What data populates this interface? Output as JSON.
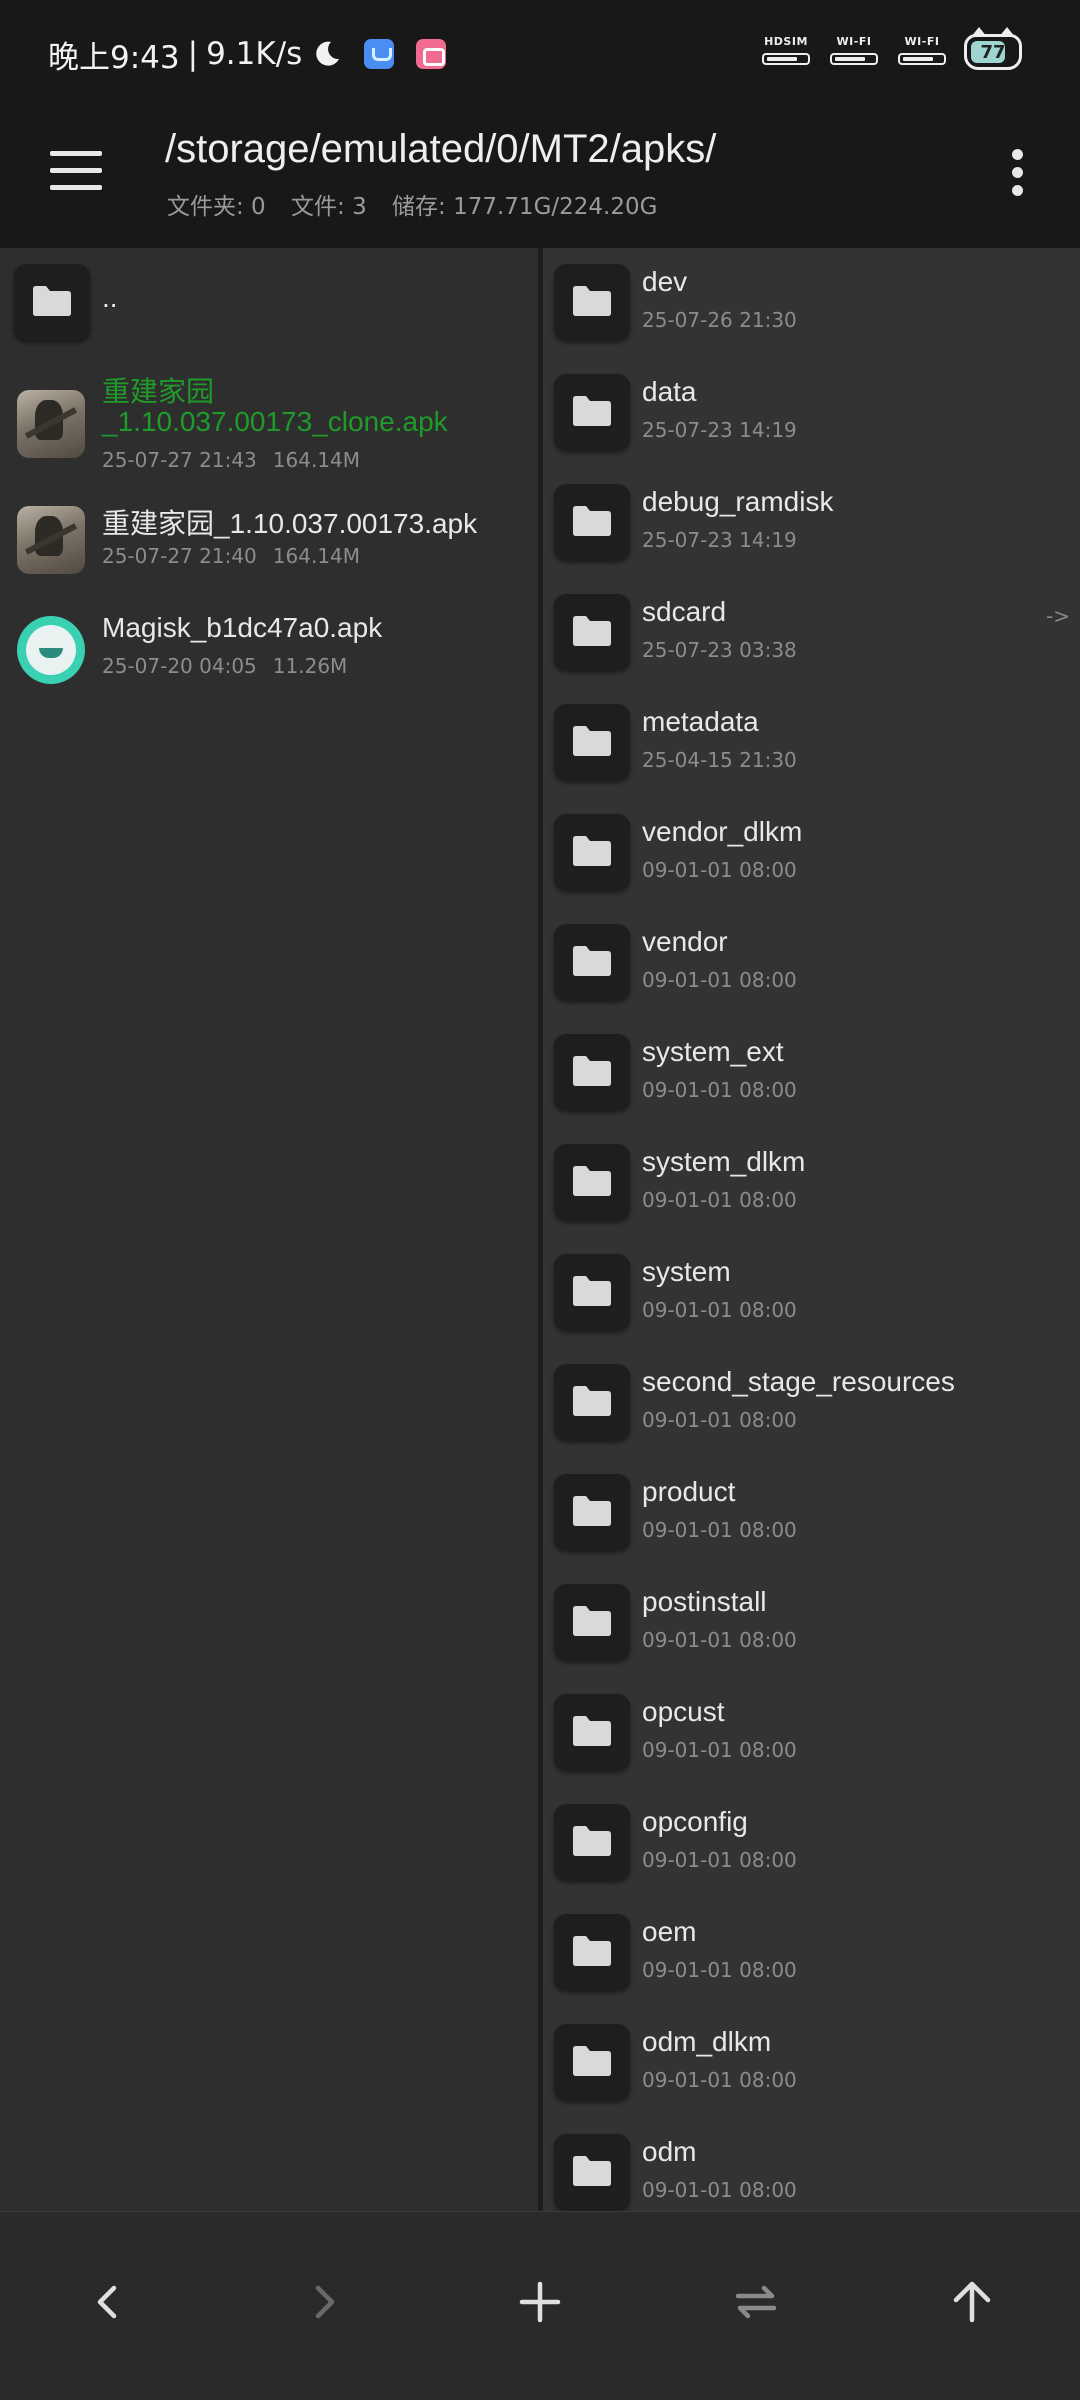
{
  "status_bar": {
    "time": "晚上9:43",
    "separator": "|",
    "net_speed": "9.1K/s",
    "sim_label": "HDSIM",
    "wifi1_label": "WI-FI",
    "wifi2_label": "WI-FI",
    "battery": "77"
  },
  "header": {
    "path": "/storage/emulated/0/MT2/apks/",
    "folders": "文件夹: 0",
    "files": "文件: 3",
    "storage": "储存: 177.71G/224.20G"
  },
  "left_pane": {
    "parent_label": "..",
    "files": [
      {
        "name_line1": "重建家园",
        "name_line2": "_1.10.037.00173_clone.apk",
        "date": "25-07-27 21:43",
        "size": "164.14M",
        "icon": "game-apk-icon",
        "highlight": true
      },
      {
        "name": "重建家园_1.10.037.00173.apk",
        "date": "25-07-27 21:40",
        "size": "164.14M",
        "icon": "game-apk-icon"
      },
      {
        "name": "Magisk_b1dc47a0.apk",
        "date": "25-07-20 04:05",
        "size": "11.26M",
        "icon": "magisk-apk-icon"
      }
    ]
  },
  "right_pane": {
    "symlink_marker": "->",
    "folders": [
      {
        "name": "dev",
        "date": "25-07-26 21:30"
      },
      {
        "name": "data",
        "date": "25-07-23 14:19"
      },
      {
        "name": "debug_ramdisk",
        "date": "25-07-23 14:19"
      },
      {
        "name": "sdcard",
        "date": "25-07-23 03:38"
      },
      {
        "name": "metadata",
        "date": "25-04-15 21:30"
      },
      {
        "name": "vendor_dlkm",
        "date": "09-01-01 08:00"
      },
      {
        "name": "vendor",
        "date": "09-01-01 08:00"
      },
      {
        "name": "system_ext",
        "date": "09-01-01 08:00"
      },
      {
        "name": "system_dlkm",
        "date": "09-01-01 08:00"
      },
      {
        "name": "system",
        "date": "09-01-01 08:00"
      },
      {
        "name": "second_stage_resources",
        "date": "09-01-01 08:00"
      },
      {
        "name": "product",
        "date": "09-01-01 08:00"
      },
      {
        "name": "postinstall",
        "date": "09-01-01 08:00"
      },
      {
        "name": "opcust",
        "date": "09-01-01 08:00"
      },
      {
        "name": "opconfig",
        "date": "09-01-01 08:00"
      },
      {
        "name": "oem",
        "date": "09-01-01 08:00"
      },
      {
        "name": "odm_dlkm",
        "date": "09-01-01 08:00"
      },
      {
        "name": "odm",
        "date": "09-01-01 08:00"
      }
    ]
  },
  "colors": {
    "highlight_green": "#1f9b2a",
    "bar_background": "#181818",
    "pane_background": "#2e2e2e"
  }
}
